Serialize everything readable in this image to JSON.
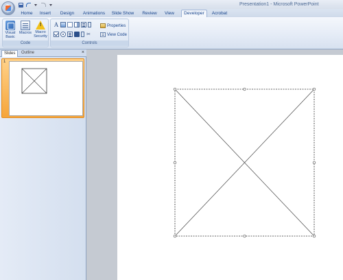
{
  "window": {
    "title_doc": "Presentation1 - ",
    "title_app": "Microsoft PowerPoint"
  },
  "qat": {
    "save_icon": "save-icon",
    "undo_icon": "undo-icon",
    "redo_icon": "redo-icon",
    "customize_icon": "qat-customize-icon"
  },
  "tabs": [
    {
      "label": "Home"
    },
    {
      "label": "Insert"
    },
    {
      "label": "Design"
    },
    {
      "label": "Animations"
    },
    {
      "label": "Slide Show"
    },
    {
      "label": "Review"
    },
    {
      "label": "View"
    },
    {
      "label": "Developer"
    },
    {
      "label": "Acrobat"
    }
  ],
  "active_tab": "Developer",
  "ribbon": {
    "code_group": {
      "label": "Code",
      "visual_basic_line1": "Visual",
      "visual_basic_line2": "Basic",
      "macros": "Macros",
      "macro_security_line1": "Macro",
      "macro_security_line2": "Security"
    },
    "controls_group": {
      "label": "Controls",
      "label_icon": "A",
      "properties": "Properties",
      "view_code": "View Code"
    }
  },
  "pane": {
    "tab_slides": "Slides",
    "tab_outline": "Outline",
    "close": "×",
    "slide_number": "1"
  },
  "colors": {
    "accent_selection": "#f6a53a",
    "ribbon_text": "#15428b"
  }
}
